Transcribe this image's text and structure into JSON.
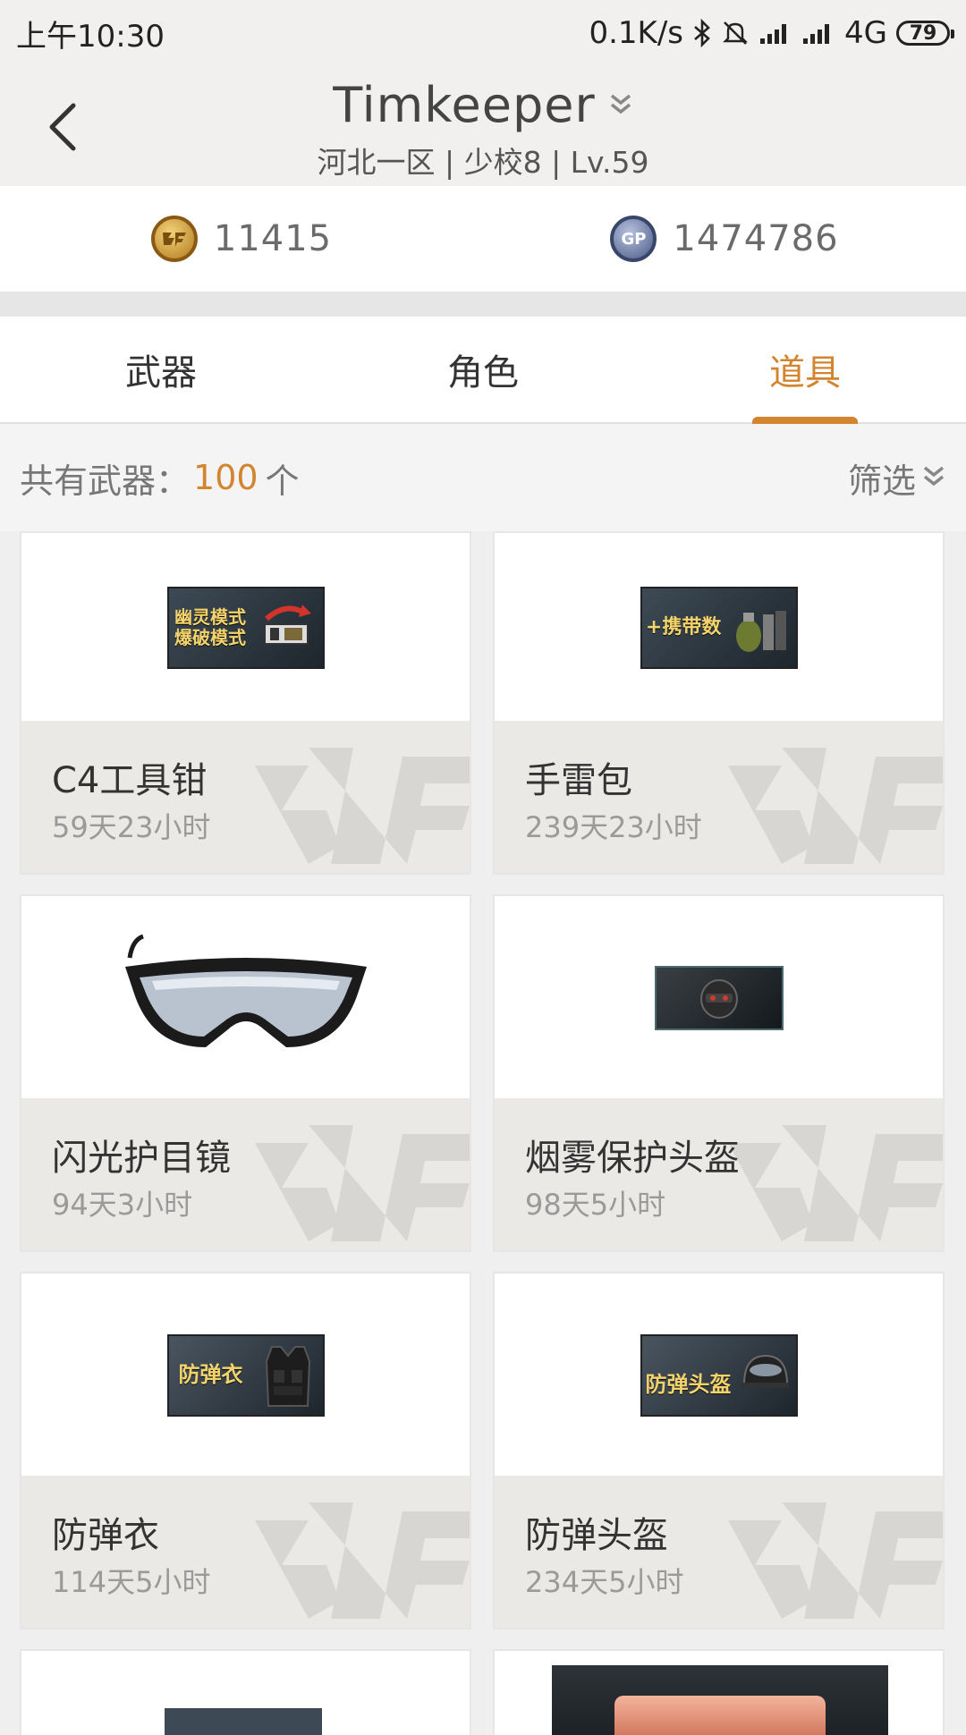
{
  "status_bar": {
    "time": "上午10:30",
    "net_speed": "0.1K/s",
    "network": "4G",
    "battery": "79"
  },
  "header": {
    "title": "Timkeeper",
    "subtitle": "河北一区 | 少校8 | Lv.59"
  },
  "currency": {
    "cf_amount": "11415",
    "gp_amount": "1474786",
    "gp_label": "GP"
  },
  "tabs": [
    {
      "label": "武器",
      "active": false
    },
    {
      "label": "角色",
      "active": false
    },
    {
      "label": "道具",
      "active": true
    }
  ],
  "summary": {
    "prefix": "共有武器：",
    "count": "100",
    "unit": "个",
    "filter_label": "筛选"
  },
  "items": [
    {
      "name": "C4工具钳",
      "time": "59天23小时",
      "thumb_text": "幽灵模式\n爆破模式"
    },
    {
      "name": "手雷包",
      "time": "239天23小时",
      "thumb_text": "+携带数"
    },
    {
      "name": "闪光护目镜",
      "time": "94天3小时",
      "thumb_text": ""
    },
    {
      "name": "烟雾保护头盔",
      "time": "98天5小时",
      "thumb_text": ""
    },
    {
      "name": "防弹衣",
      "time": "114天5小时",
      "thumb_text": "防弹衣"
    },
    {
      "name": "防弹头盔",
      "time": "234天5小时",
      "thumb_text": "防弹头盔"
    }
  ],
  "colors": {
    "accent": "#d2842e",
    "header_bg": "#f1f0ee",
    "card_info_bg": "#ebe9e6"
  }
}
